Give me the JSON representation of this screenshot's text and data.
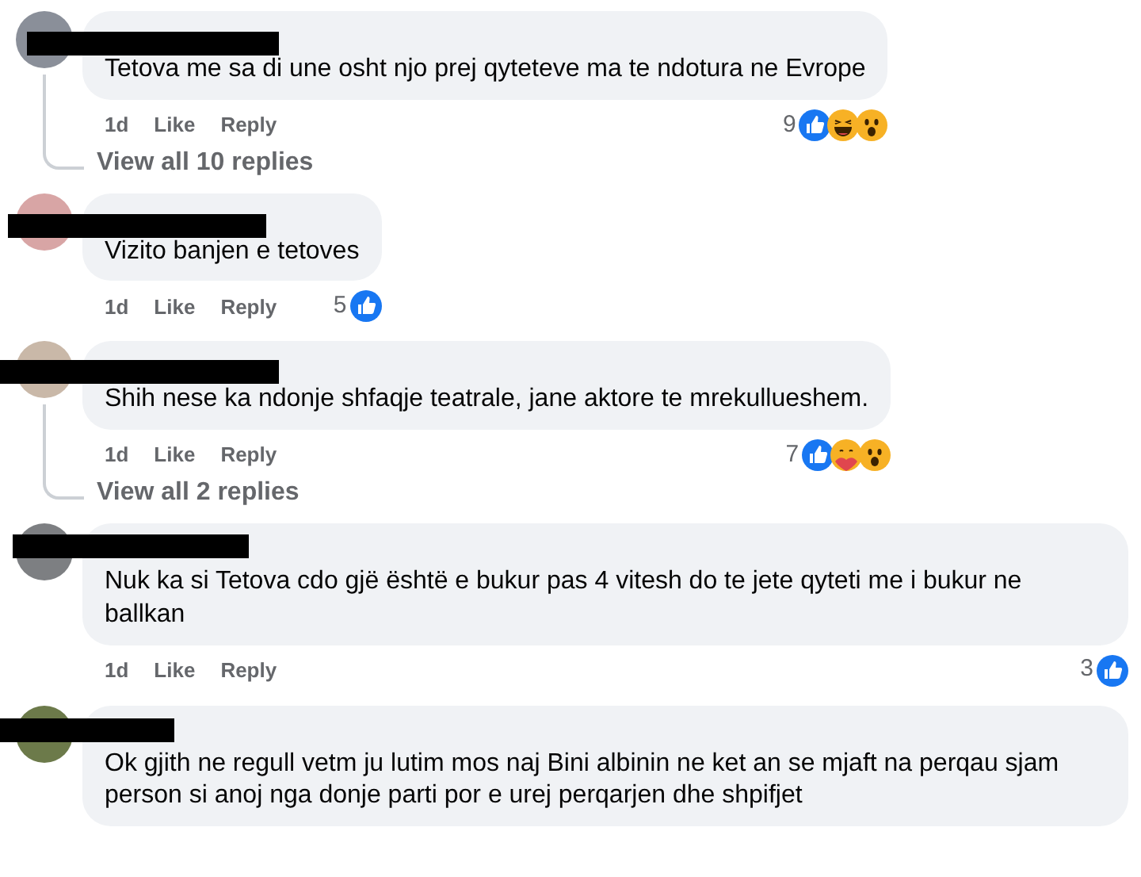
{
  "comments": [
    {
      "redacted": true,
      "text": "Tetova me sa di une osht njo prej qyteteve ma te ndotura ne Evrope",
      "time": "1d",
      "like": "Like",
      "reply": "Reply",
      "reaction_count": "9",
      "reactions": [
        {
          "kind": "like"
        },
        {
          "kind": "haha"
        },
        {
          "kind": "wow"
        }
      ],
      "view_replies": "View all 10 replies"
    },
    {
      "redacted": true,
      "text": "Vizito banjen e tetoves",
      "time": "1d",
      "like": "Like",
      "reply": "Reply",
      "reaction_count": "5",
      "reactions": [
        {
          "kind": "like"
        }
      ]
    },
    {
      "redacted": true,
      "text": "Shih nese ka ndonje shfaqje teatrale, jane aktore te mrekullueshem.",
      "time": "1d",
      "like": "Like",
      "reply": "Reply",
      "reaction_count": "7",
      "reactions": [
        {
          "kind": "like"
        },
        {
          "kind": "care"
        },
        {
          "kind": "wow"
        }
      ],
      "view_replies": "View all 2 replies"
    },
    {
      "redacted": true,
      "text": "Nuk ka si Tetova cdo gjë është e bukur pas 4 vitesh do te jete qyteti me i bukur ne ballkan",
      "time": "1d",
      "like": "Like",
      "reply": "Reply",
      "reaction_count": "3",
      "reactions": [
        {
          "kind": "like"
        }
      ]
    },
    {
      "redacted": true,
      "text": "Ok gjith ne regull vetm ju lutim mos naj Bini albinin ne ket an se mjaft na perqau sjam person si anoj nga donje parti por e urej perqarjen dhe shpifjet"
    }
  ]
}
